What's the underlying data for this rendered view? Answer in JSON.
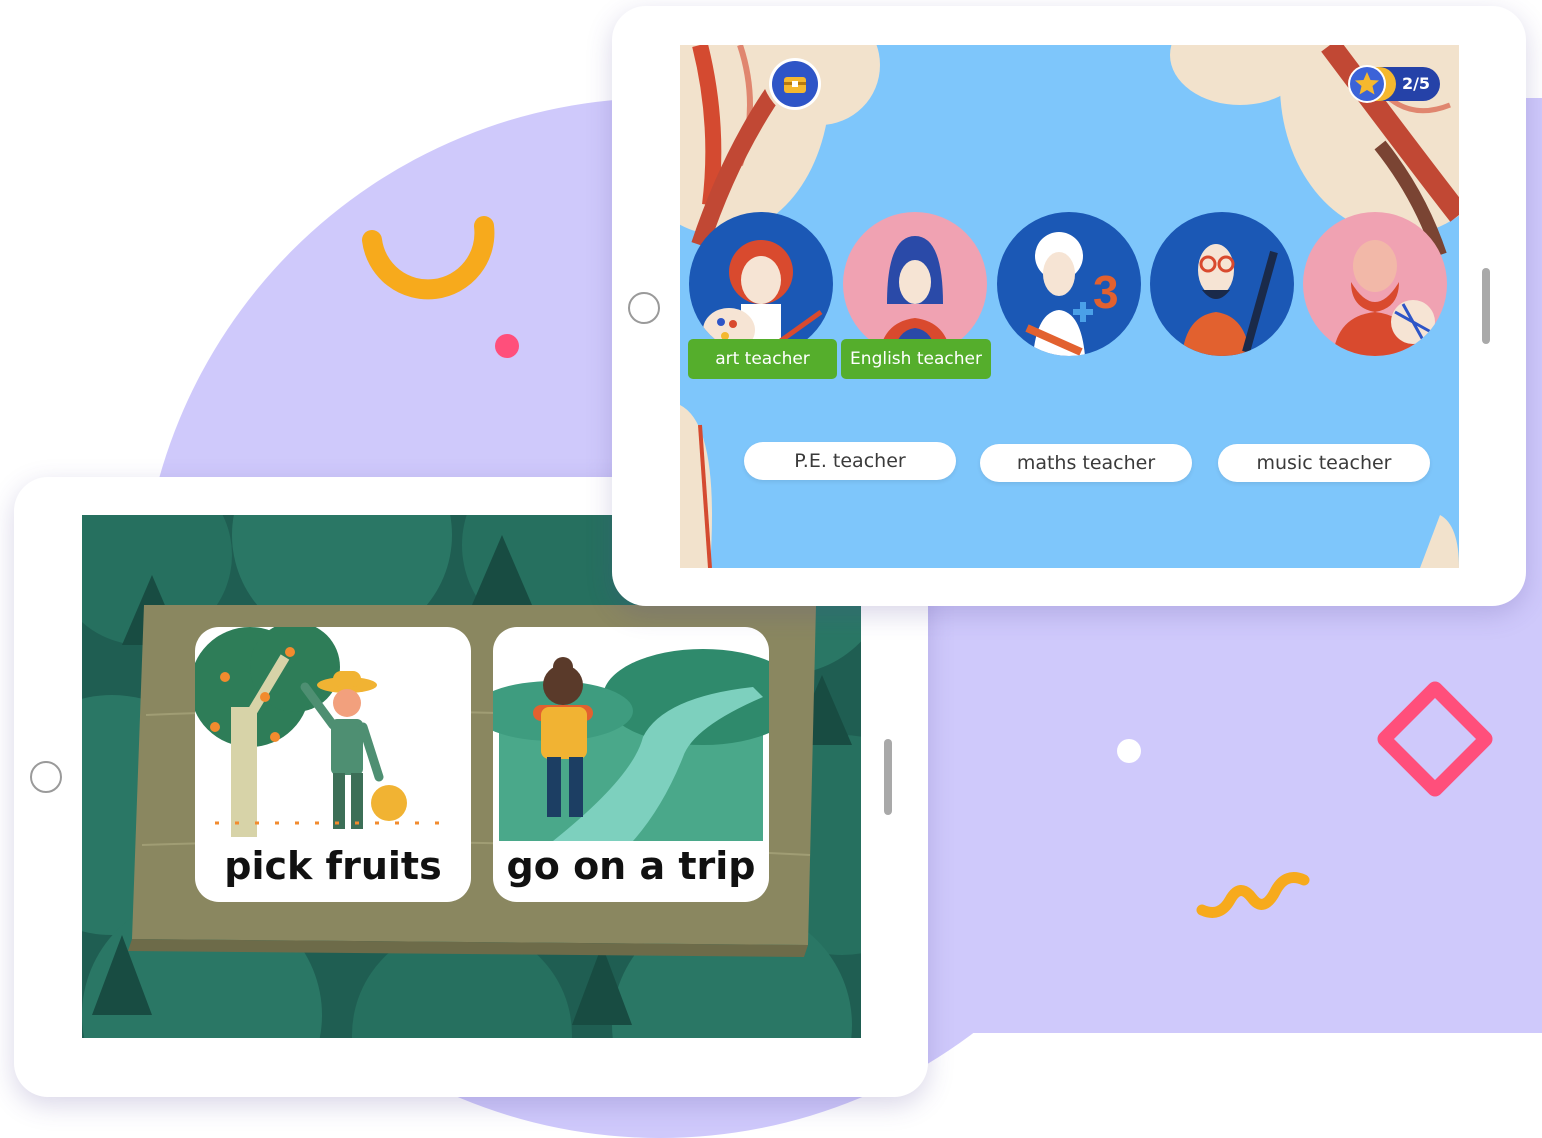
{
  "game_top": {
    "progress_text": "2/5",
    "matched_labels": [
      "art teacher",
      "English teacher"
    ],
    "answer_options": [
      "P.E. teacher",
      "maths teacher",
      "music teacher"
    ],
    "icons": {
      "chest": "treasure-chest-icon",
      "star": "star-icon"
    }
  },
  "game_bottom": {
    "cards": [
      {
        "label": "pick fruits",
        "image": "farmer-picking-fruits"
      },
      {
        "label": "go on a trip",
        "image": "hiker-with-backpack"
      }
    ]
  },
  "colors": {
    "lavender": "#cfc9fb",
    "sky": "#7ec6fb",
    "label_green": "#55ae2c",
    "forest": "#1f5e52",
    "wood": "#8a8760",
    "yellow_shape": "#f7aa1c",
    "pink_shape": "#ff4f7b"
  }
}
